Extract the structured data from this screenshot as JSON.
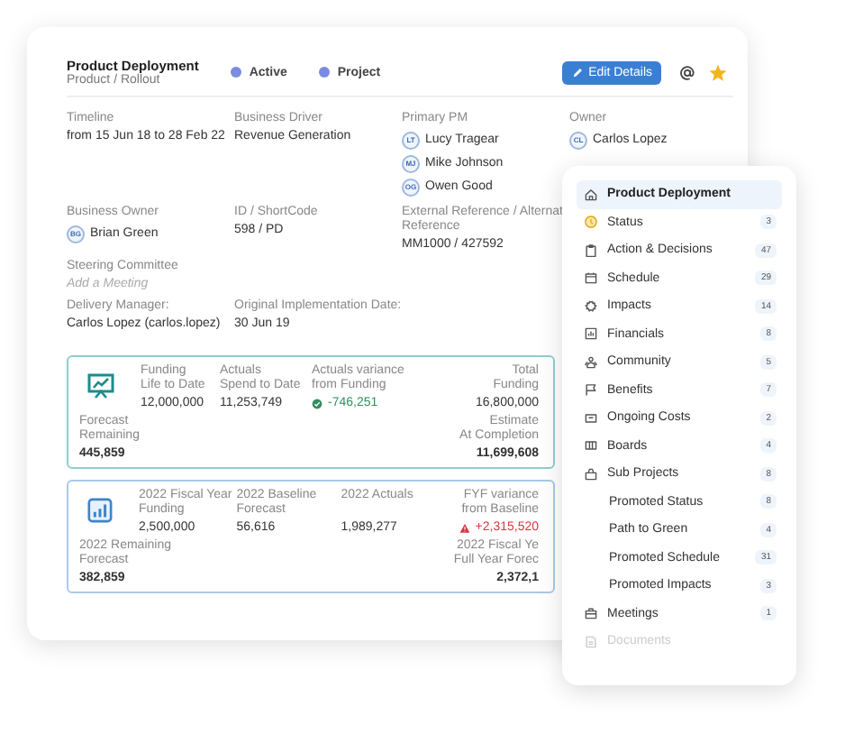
{
  "header": {
    "title": "Product Deployment",
    "subtitle": "Product / Rollout",
    "tags": [
      {
        "label": "Active"
      },
      {
        "label": "Project"
      }
    ],
    "edit_button": "Edit Details",
    "starred": true
  },
  "field_rows": [
    [
      {
        "label": "Timeline",
        "kind": "text",
        "value": "from 15 Jun 18 to 28 Feb 22"
      },
      {
        "label": "Business Driver",
        "kind": "text",
        "value": "Revenue Generation"
      },
      {
        "label": "Primary PM",
        "kind": "people",
        "people": [
          {
            "initials": "LT",
            "name": "Lucy Tragear"
          },
          {
            "initials": "MJ",
            "name": "Mike Johnson"
          },
          {
            "initials": "OG",
            "name": "Owen Good"
          }
        ]
      },
      {
        "label": "Owner",
        "kind": "people",
        "people": [
          {
            "initials": "CL",
            "name": "Carlos Lopez"
          }
        ]
      }
    ],
    [
      {
        "label": "Business Owner",
        "kind": "people",
        "people": [
          {
            "initials": "BG",
            "name": "Brian Green"
          }
        ]
      },
      {
        "label": "ID / ShortCode",
        "kind": "text",
        "value": "598 / PD"
      },
      {
        "label": "External Reference / Alternat Reference",
        "kind": "text",
        "value": "MM1000 / 427592"
      }
    ],
    [
      {
        "label": "Steering Committee",
        "kind": "link",
        "value": "Add a Meeting"
      }
    ],
    [
      {
        "label": "Delivery Manager:",
        "kind": "text",
        "value": "Carlos Lopez (carlos.lopez)"
      },
      {
        "label": "Original Implementation Date:",
        "kind": "text",
        "value": "30 Jun 19"
      }
    ]
  ],
  "finance_cards": [
    {
      "kind": "project",
      "metrics": [
        {
          "label": "Funding\nLife to Date",
          "value": "12,000,000",
          "kind": "plain"
        },
        {
          "label": "Actuals\nSpend to Date",
          "value": "11,253,749",
          "kind": "plain"
        },
        {
          "label": "Actuals variance\nfrom Funding",
          "value": "-746,251",
          "kind": "good"
        }
      ],
      "top_right": {
        "label": "Total\nFunding",
        "value": "16,800,000",
        "kind": "plain"
      },
      "bottom_left": {
        "label": "Forecast\nRemaining",
        "value": "445,859"
      },
      "bottom_right": {
        "label": "Estimate\nAt Completion",
        "value": "11,699,608"
      }
    },
    {
      "kind": "fiscal",
      "metrics": [
        {
          "label": "2022 Fiscal Year\nFunding",
          "value": "2,500,000",
          "kind": "plain"
        },
        {
          "label": "2022 Baseline\nForecast",
          "value": "56,616",
          "kind": "plain"
        },
        {
          "label": "2022 Actuals",
          "value": "1,989,277",
          "kind": "plain"
        }
      ],
      "top_right": {
        "label": "FYF variance\nfrom Baseline",
        "value": "+2,315,520",
        "kind": "bad"
      },
      "bottom_left": {
        "label": "2022 Remaining\nForecast",
        "value": "382,859"
      },
      "bottom_right": {
        "label": "2022 Fiscal Ye\nFull Year Forec",
        "value": "2,372,1"
      }
    }
  ],
  "nav": [
    {
      "label": "Product Deployment",
      "selected": true,
      "disabled": false
    },
    {
      "label": "Status",
      "count": "3",
      "selected": false,
      "disabled": false
    },
    {
      "label": "Action & Decisions",
      "count": "47",
      "selected": false,
      "disabled": false
    },
    {
      "label": "Schedule",
      "count": "29",
      "selected": false,
      "disabled": false
    },
    {
      "label": "Impacts",
      "count": "14",
      "selected": false,
      "disabled": false
    },
    {
      "label": "Financials",
      "count": "8",
      "selected": false,
      "disabled": false
    },
    {
      "label": "Community",
      "count": "5",
      "selected": false,
      "disabled": false
    },
    {
      "label": "Benefits",
      "count": "7",
      "selected": false,
      "disabled": false
    },
    {
      "label": "Ongoing Costs",
      "count": "2",
      "selected": false,
      "disabled": false
    },
    {
      "label": "Boards",
      "count": "4",
      "selected": false,
      "disabled": false
    },
    {
      "label": "Sub Projects",
      "count": "8",
      "selected": false,
      "disabled": false,
      "children": [
        {
          "label": "Promoted Status",
          "count": "8",
          "selected": false,
          "disabled": false
        },
        {
          "label": "Path to Green",
          "count": "4",
          "selected": false,
          "disabled": false
        },
        {
          "label": "Promoted Schedule",
          "count": "31",
          "selected": false,
          "disabled": false
        },
        {
          "label": "Promoted Impacts",
          "count": "3",
          "selected": false,
          "disabled": false
        }
      ]
    },
    {
      "label": "Meetings",
      "count": "1",
      "selected": false,
      "disabled": false
    },
    {
      "label": "Documents",
      "selected": false,
      "disabled": true
    }
  ]
}
